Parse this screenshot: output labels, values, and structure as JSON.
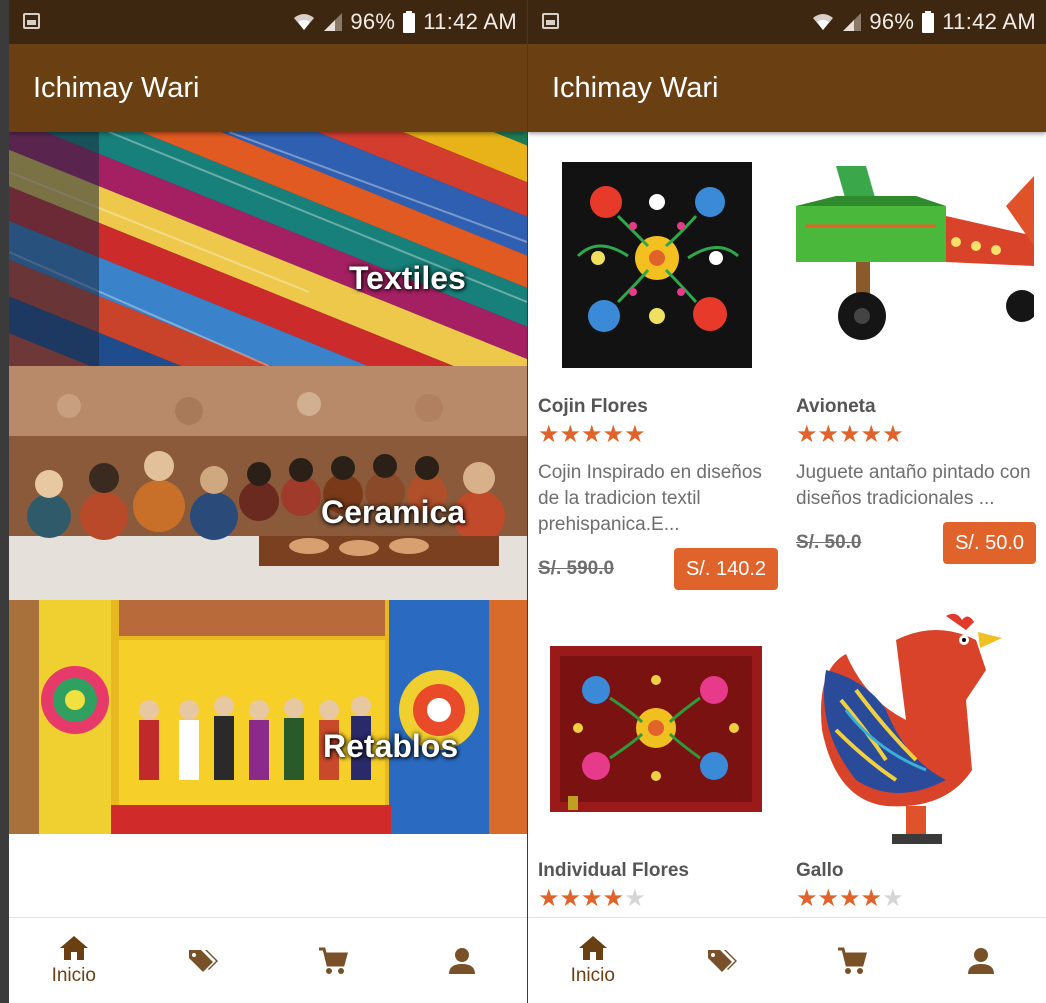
{
  "status": {
    "battery": "96%",
    "time": "11:42 AM"
  },
  "app": {
    "title": "Ichimay Wari"
  },
  "categories": [
    {
      "label": "Textiles"
    },
    {
      "label": "Ceramica"
    },
    {
      "label": "Retablos"
    }
  ],
  "products": [
    {
      "name": "Cojin Flores",
      "rating": 5,
      "stars_on": "★★★★★",
      "stars_off": "",
      "description": "Cojin Inspirado en diseños de la tradicion textil prehispanica.E...",
      "old_price": "S/. 590.0",
      "price": "S/. 140.2"
    },
    {
      "name": "Avioneta",
      "rating": 5,
      "stars_on": "★★★★★",
      "stars_off": "",
      "description": "Juguete antaño pintado con diseños tradicionales ...",
      "old_price": "S/. 50.0",
      "price": "S/. 50.0"
    },
    {
      "name": "Individual Flores",
      "rating": 4,
      "stars_on": "★★★★",
      "stars_off": "★"
    },
    {
      "name": "Gallo",
      "rating": 4,
      "stars_on": "★★★★",
      "stars_off": "★"
    }
  ],
  "nav": {
    "home_label": "Inicio"
  },
  "icons": [
    "image-icon",
    "wifi-icon",
    "signal-icon",
    "battery-icon",
    "home-icon",
    "tag-icon",
    "cart-icon",
    "person-icon"
  ],
  "colors": {
    "appbar": "#6a3f12",
    "statusbar": "#3e2710",
    "accent": "#e0632b",
    "nav": "#6a3f12"
  }
}
